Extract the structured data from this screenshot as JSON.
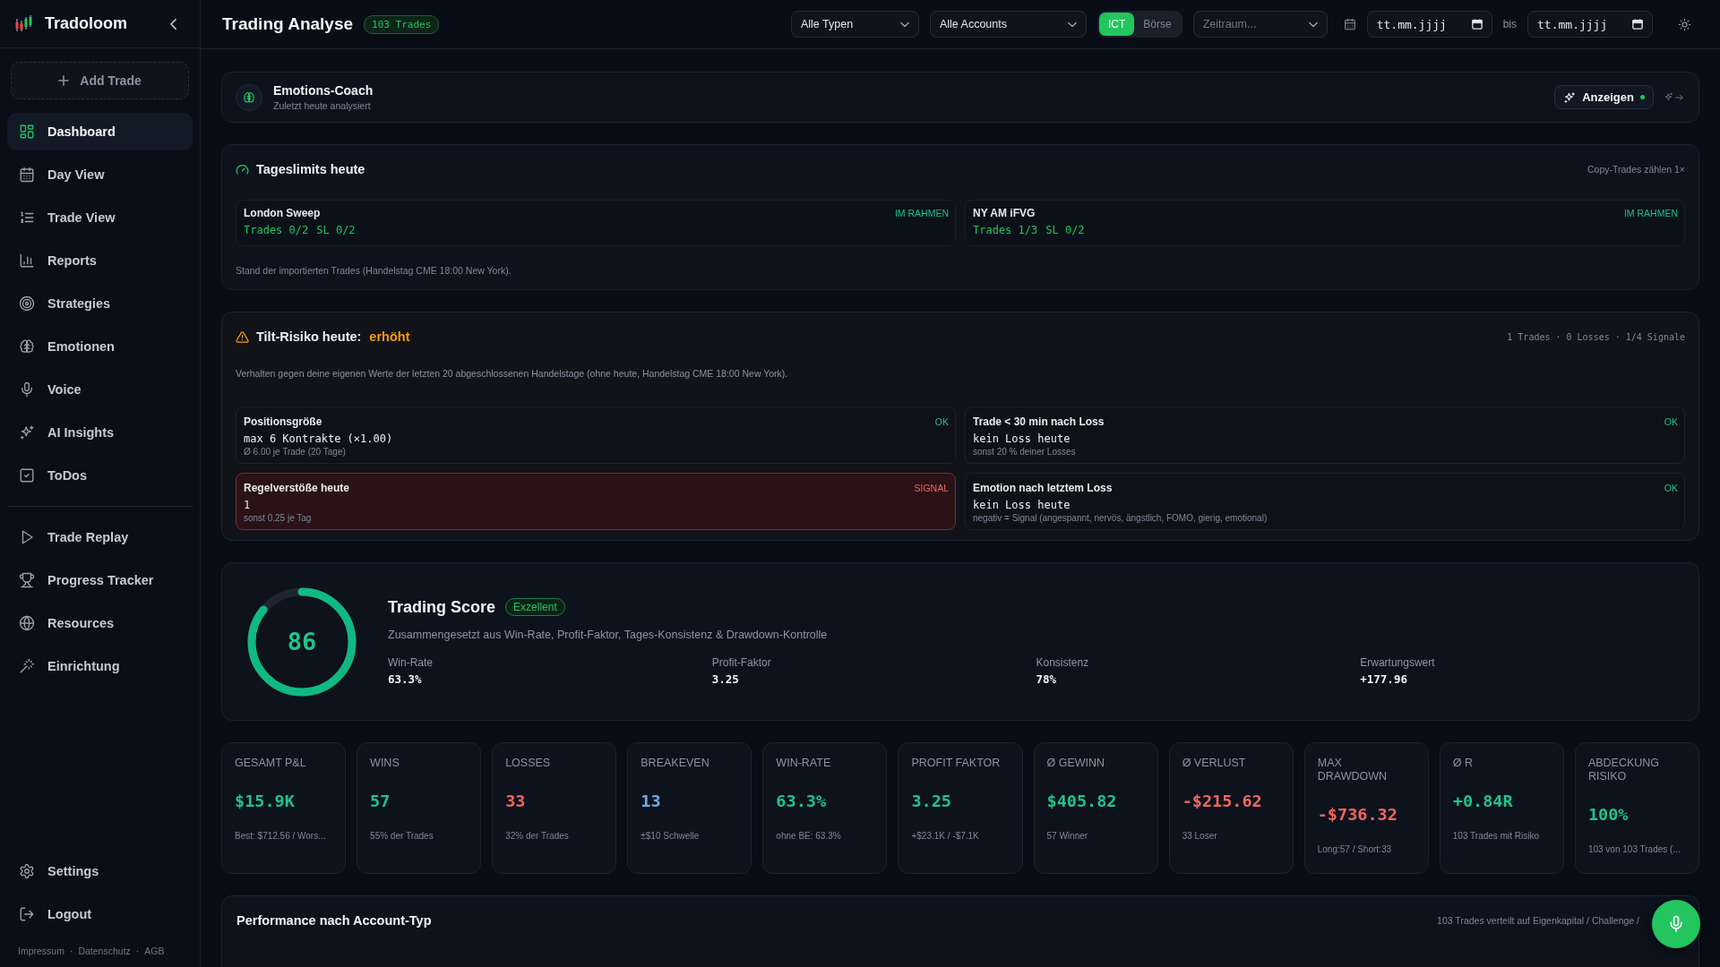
{
  "sidebar": {
    "brand": "Tradoloom",
    "add_button": "Add Trade",
    "nav": [
      {
        "label": "Dashboard",
        "selected": true
      },
      {
        "label": "Day View",
        "selected": false
      },
      {
        "label": "Trade View",
        "selected": false
      },
      {
        "label": "Reports",
        "selected": false
      },
      {
        "label": "Strategies",
        "selected": false
      },
      {
        "label": "Emotionen",
        "selected": false
      },
      {
        "label": "Voice",
        "selected": false
      },
      {
        "label": "AI Insights",
        "selected": false
      },
      {
        "label": "ToDos",
        "selected": false
      }
    ],
    "nav_secondary": [
      {
        "label": "Trade Replay",
        "selected": false
      },
      {
        "label": "Progress Tracker",
        "selected": false
      },
      {
        "label": "Resources",
        "selected": false
      },
      {
        "label": "Einrichtung",
        "selected": false
      }
    ],
    "bottom_nav": [
      "Settings",
      "Logout"
    ],
    "footer_links": [
      "Impressum",
      "Datenschutz",
      "AGB"
    ],
    "footer_separator": "·"
  },
  "header": {
    "title": "Trading Analyse",
    "badge": "103 Trades",
    "type_filter": {
      "value": "Alle Typen"
    },
    "account_filter": {
      "value": "Alle Accounts"
    },
    "market_toggle": [
      {
        "label": "ICT",
        "selected": true
      },
      {
        "label": "Börse",
        "selected": false
      }
    ],
    "period_filter": {
      "placeholder": "Zeitraum..."
    },
    "date_from": {
      "placeholder": "tt.mm.jjjj"
    },
    "date_separator": "bis",
    "date_to": {
      "placeholder": "tt.mm.jjjj"
    }
  },
  "emotions_coach": {
    "title": "Emotions-Coach",
    "subtitle": "Zuletzt heute analysiert",
    "button": "Anzeigen"
  },
  "daily_limits": {
    "title": "Tageslimits heute",
    "note": "Copy-Trades zählen 1×",
    "strategies": [
      {
        "name": "London Sweep",
        "status": "IM RAHMEN",
        "trades": "Trades 0/2",
        "stop_loss": "SL 0/2"
      },
      {
        "name": "NY AM iFVG",
        "status": "IM RAHMEN",
        "trades": "Trades 1/3",
        "stop_loss": "SL 0/2"
      }
    ],
    "footnote": "Stand der importierten Trades (Handelstag CME 18:00 New York)."
  },
  "tilt_risk": {
    "title": "Tilt-Risiko heute:",
    "level_label": "erhöht",
    "summary": "1 Trades · 0 Losses · 1/4 Signale",
    "description": "Verhalten gegen deine eigenen Werte der letzten 20 abgeschlossenen Handelstage (ohne heute, Handelstag CME 18:00 New York).",
    "items": [
      {
        "name": "Positionsgröße",
        "status": "OK",
        "signal": false,
        "value": "max 6 Kontrakte (×1.00)",
        "detail": "Ø 6.00 je Trade (20 Tage)"
      },
      {
        "name": "Trade < 30 min nach Loss",
        "status": "OK",
        "signal": false,
        "value": "kein Loss heute",
        "detail": "sonst 20 % deiner Losses"
      },
      {
        "name": "Regelverstöße heute",
        "status": "SIGNAL",
        "signal": true,
        "value": "1",
        "detail": "sonst 0.25 je Tag"
      },
      {
        "name": "Emotion nach letztem Loss",
        "status": "OK",
        "signal": false,
        "value": "kein Loss heute",
        "detail": "negativ = Signal (angespannt, nervös, ängstlich, FOMO, gierig, emotional)"
      }
    ]
  },
  "trading_score": {
    "value": "86",
    "level": 0.86,
    "title": "Trading Score",
    "badge": "Exzellent",
    "description": "Zusammengesetzt aus Win-Rate, Profit-Faktor, Tages-Konsistenz & Drawdown-Kontrolle",
    "metrics": [
      {
        "label": "Win-Rate",
        "value": "63.3%"
      },
      {
        "label": "Profit-Faktor",
        "value": "3.25"
      },
      {
        "label": "Konsistenz",
        "value": "78%"
      },
      {
        "label": "Erwartungswert",
        "value": "+177.96"
      }
    ]
  },
  "stats": [
    {
      "label": "GESAMT P&L",
      "value": "$15.9K",
      "color": "#1fc48a",
      "note": "Best: $712.56 / Wors..."
    },
    {
      "label": "WINS",
      "value": "57",
      "color": "#1fc48a",
      "note": "55% der Trades"
    },
    {
      "label": "LOSSES",
      "value": "33",
      "color": "#f2655f",
      "note": "32% der Trades"
    },
    {
      "label": "BREAKEVEN",
      "value": "13",
      "color": "#74a9e3",
      "note": "±$10 Schwelle"
    },
    {
      "label": "WIN-RATE",
      "value": "63.3%",
      "color": "#1fc48a",
      "note": "ohne BE: 63.3%"
    },
    {
      "label": "PROFIT FAKTOR",
      "value": "3.25",
      "color": "#1fc48a",
      "note": "+$23.1K / -$7.1K"
    },
    {
      "label": "Ø GEWINN",
      "value": "$405.82",
      "color": "#1fc48a",
      "note": "57 Winner"
    },
    {
      "label": "Ø VERLUST",
      "value": "-$215.62",
      "color": "#f2655f",
      "note": "33 Loser"
    },
    {
      "label": "MAX DRAWDOWN",
      "value": "-$736.32",
      "color": "#f2655f",
      "note": "Long:57 / Short:33"
    },
    {
      "label": "Ø R",
      "value": "+0.84R",
      "color": "#1fc48a",
      "note": "103 Trades mit Risiko"
    },
    {
      "label": "ABDECKUNG RISIKO",
      "value": "100%",
      "color": "#1fc48a",
      "note": "103 von 103 Trades (..."
    }
  ],
  "performance": {
    "title": "Performance nach Account-Typ",
    "note": "103 Trades verteilt auf Eigenkapital / Challenge /"
  }
}
